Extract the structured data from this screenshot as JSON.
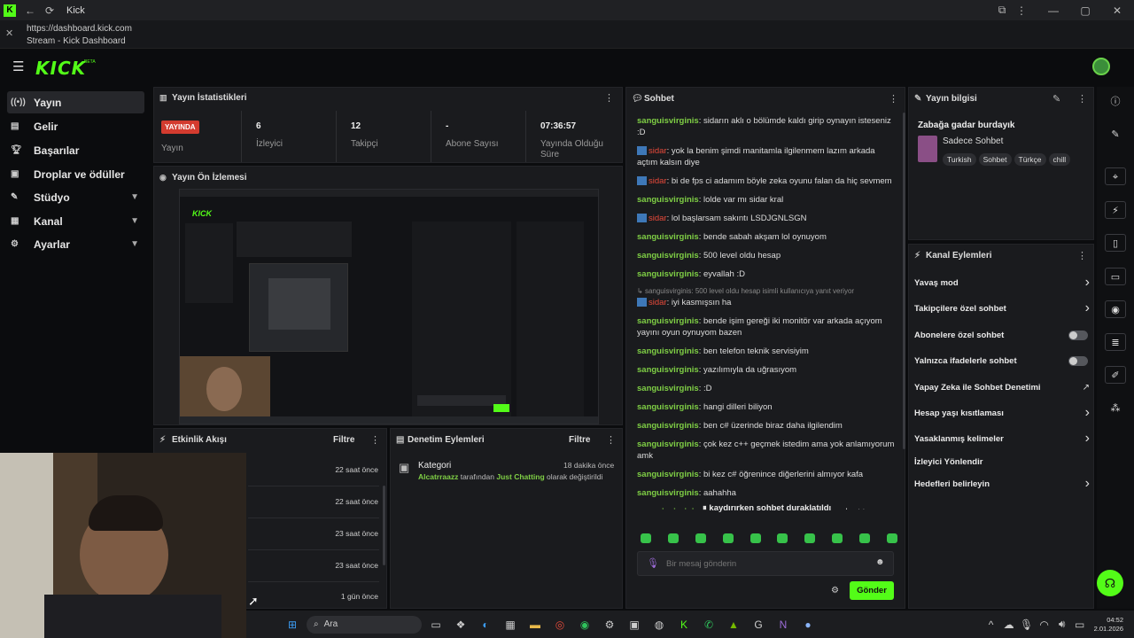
{
  "window": {
    "title": "Kick"
  },
  "urlbar": {
    "url": "https://dashboard.kick.com",
    "page_title": "Stream - Kick Dashboard"
  },
  "header": {
    "logo": "KICK",
    "beta": "BETA"
  },
  "sidebar": {
    "items": [
      {
        "label": "Yayın",
        "icon": "broadcast-icon"
      },
      {
        "label": "Gelir",
        "icon": "revenue-icon"
      },
      {
        "label": "Başarılar",
        "icon": "trophy-icon"
      },
      {
        "label": "Droplar ve ödüller",
        "icon": "gift-icon"
      },
      {
        "label": "Stüdyo",
        "icon": "studio-icon"
      },
      {
        "label": "Kanal",
        "icon": "channel-icon"
      },
      {
        "label": "Ayarlar",
        "icon": "gear-icon"
      }
    ]
  },
  "stats": {
    "title": "Yayın İstatistikleri",
    "live_badge": "YAYINDA",
    "live_label": "Yayın",
    "viewers_value": "6",
    "viewers_label": "İzleyici",
    "followers_value": "12",
    "followers_label": "Takipçi",
    "subs_value": "-",
    "subs_label": "Abone Sayısı",
    "uptime_value": "07:36:57",
    "uptime_label": "Yayında Olduğu Süre"
  },
  "preview": {
    "title": "Yayın Ön İzlemesi"
  },
  "activity": {
    "title": "Etkinlik Akışı",
    "filter": "Filtre",
    "times": [
      "22 saat önce",
      "22 saat önce",
      "23 saat önce",
      "23 saat önce",
      "1 gün önce"
    ]
  },
  "moderation": {
    "title": "Denetim Eylemleri",
    "filter": "Filtre",
    "item_title": "Kategori",
    "item_time": "18 dakika önce",
    "item_user": "Alcatrraazz",
    "item_mid": " tarafından ",
    "item_cat": "Just Chatting",
    "item_end": " olarak değiştirildi"
  },
  "chat": {
    "title": "Sohbet",
    "messages": [
      {
        "user": "sanguisvirginis",
        "type": "u1",
        "text": ": sidarın aklı o bölümde kaldı girip oynayın isteseniz :D",
        "badge": false
      },
      {
        "user": "sidar",
        "type": "u2",
        "text": ": yok la benim şimdi manitamla ilgilenmem lazım arkada açtım kalsın diye",
        "badge": true
      },
      {
        "user": "sidar",
        "type": "u2",
        "text": ": bi de fps ci adamım böyle zeka oyunu falan da hiç sevmem",
        "badge": true
      },
      {
        "user": "sanguisvirginis",
        "type": "u1",
        "text": ": lolde var mı sidar kral",
        "badge": false
      },
      {
        "user": "sidar",
        "type": "u2",
        "text": ": lol başlarsam sakıntı LSDJGNLSGN",
        "badge": true
      },
      {
        "user": "sanguisvirginis",
        "type": "u1",
        "text": ": bende sabah akşam lol oynuyom",
        "badge": false
      },
      {
        "user": "sanguisvirginis",
        "type": "u1",
        "text": ": 500 level oldu hesap",
        "badge": false
      },
      {
        "user": "sanguisvirginis",
        "type": "u1",
        "text": ": eyvallah :D",
        "badge": false
      }
    ],
    "reply_note": "sanguisvirginis: 500 level oldu hesap isimli kullanıcıya yanıt veriyor",
    "messages2": [
      {
        "user": "sidar",
        "type": "u2",
        "text": ": iyi kasmışsın ha",
        "badge": true
      },
      {
        "user": "sanguisvirginis",
        "type": "u1",
        "text": ": bende işim gereği iki monitör var arkada açıyom yayını oyun oynuyom bazen",
        "badge": false
      },
      {
        "user": "sanguisvirginis",
        "type": "u1",
        "text": ": ben telefon teknik servisiyim",
        "badge": false
      },
      {
        "user": "sanguisvirginis",
        "type": "u1",
        "text": ": yazılımıyla da uğrasıyom",
        "badge": false
      },
      {
        "user": "sanguisvirginis",
        "type": "u1",
        "text": ": :D",
        "badge": false
      },
      {
        "user": "sanguisvirginis",
        "type": "u1",
        "text": ": hangi dilleri biliyon",
        "badge": false
      },
      {
        "user": "sanguisvirginis",
        "type": "u1",
        "text": ": ben c# üzerinde biraz daha ilgilendim",
        "badge": false
      },
      {
        "user": "sanguisvirginis",
        "type": "u1",
        "text": ": çok kez c++ geçmek istedim ama yok anlamıyorum amk",
        "badge": false
      },
      {
        "user": "sanguisvirginis",
        "type": "u1",
        "text": ": bi kez c# öğrenince diğerlerini almıyor kafa",
        "badge": false
      },
      {
        "user": "sanguisvirginis",
        "type": "u1",
        "text": ": aahahha",
        "badge": false
      },
      {
        "user": "sanguisvirginis",
        "type": "u1",
        "text": ": birkaçkez illegal şeyler denedim olmadı c++ olmadan olmuyor herhal",
        "badge": false
      }
    ],
    "paused": "kaydırırken sohbet duraklatıldı",
    "input_placeholder": "Bir mesaj gönderin",
    "send": "Gönder"
  },
  "streaminfo": {
    "title": "Yayın bilgisi",
    "stream_title": "Zabağa gadar burdayık",
    "category": "Sadece Sohbet",
    "tags": [
      "Turkish",
      "Sohbet",
      "Türkçe",
      "chill"
    ]
  },
  "channel_actions": {
    "title": "Kanal Eylemleri",
    "items": [
      {
        "label": "Yavaş mod",
        "ctrl": "arrow"
      },
      {
        "label": "Takipçilere özel sohbet",
        "ctrl": "arrow"
      },
      {
        "label": "Abonelere özel sohbet",
        "ctrl": "toggle"
      },
      {
        "label": "Yalnızca ifadelerle sohbet",
        "ctrl": "toggle"
      },
      {
        "label": "Yapay Zeka ile Sohbet Denetimi",
        "ctrl": "external"
      },
      {
        "label": "Hesap yaşı kısıtlaması",
        "ctrl": "arrow"
      },
      {
        "label": "Yasaklanmış kelimeler",
        "ctrl": "arrow"
      },
      {
        "label": "İzleyici Yönlendir",
        "ctrl": "none"
      },
      {
        "label": "Hedefleri belirleyin",
        "ctrl": "arrow"
      }
    ]
  },
  "taskbar": {
    "search": "Ara",
    "time": "04:52",
    "date": "2.01.2026"
  },
  "colors": {
    "brand": "#53fc18",
    "live": "#d33b2f",
    "panel": "#1a1b1e"
  }
}
